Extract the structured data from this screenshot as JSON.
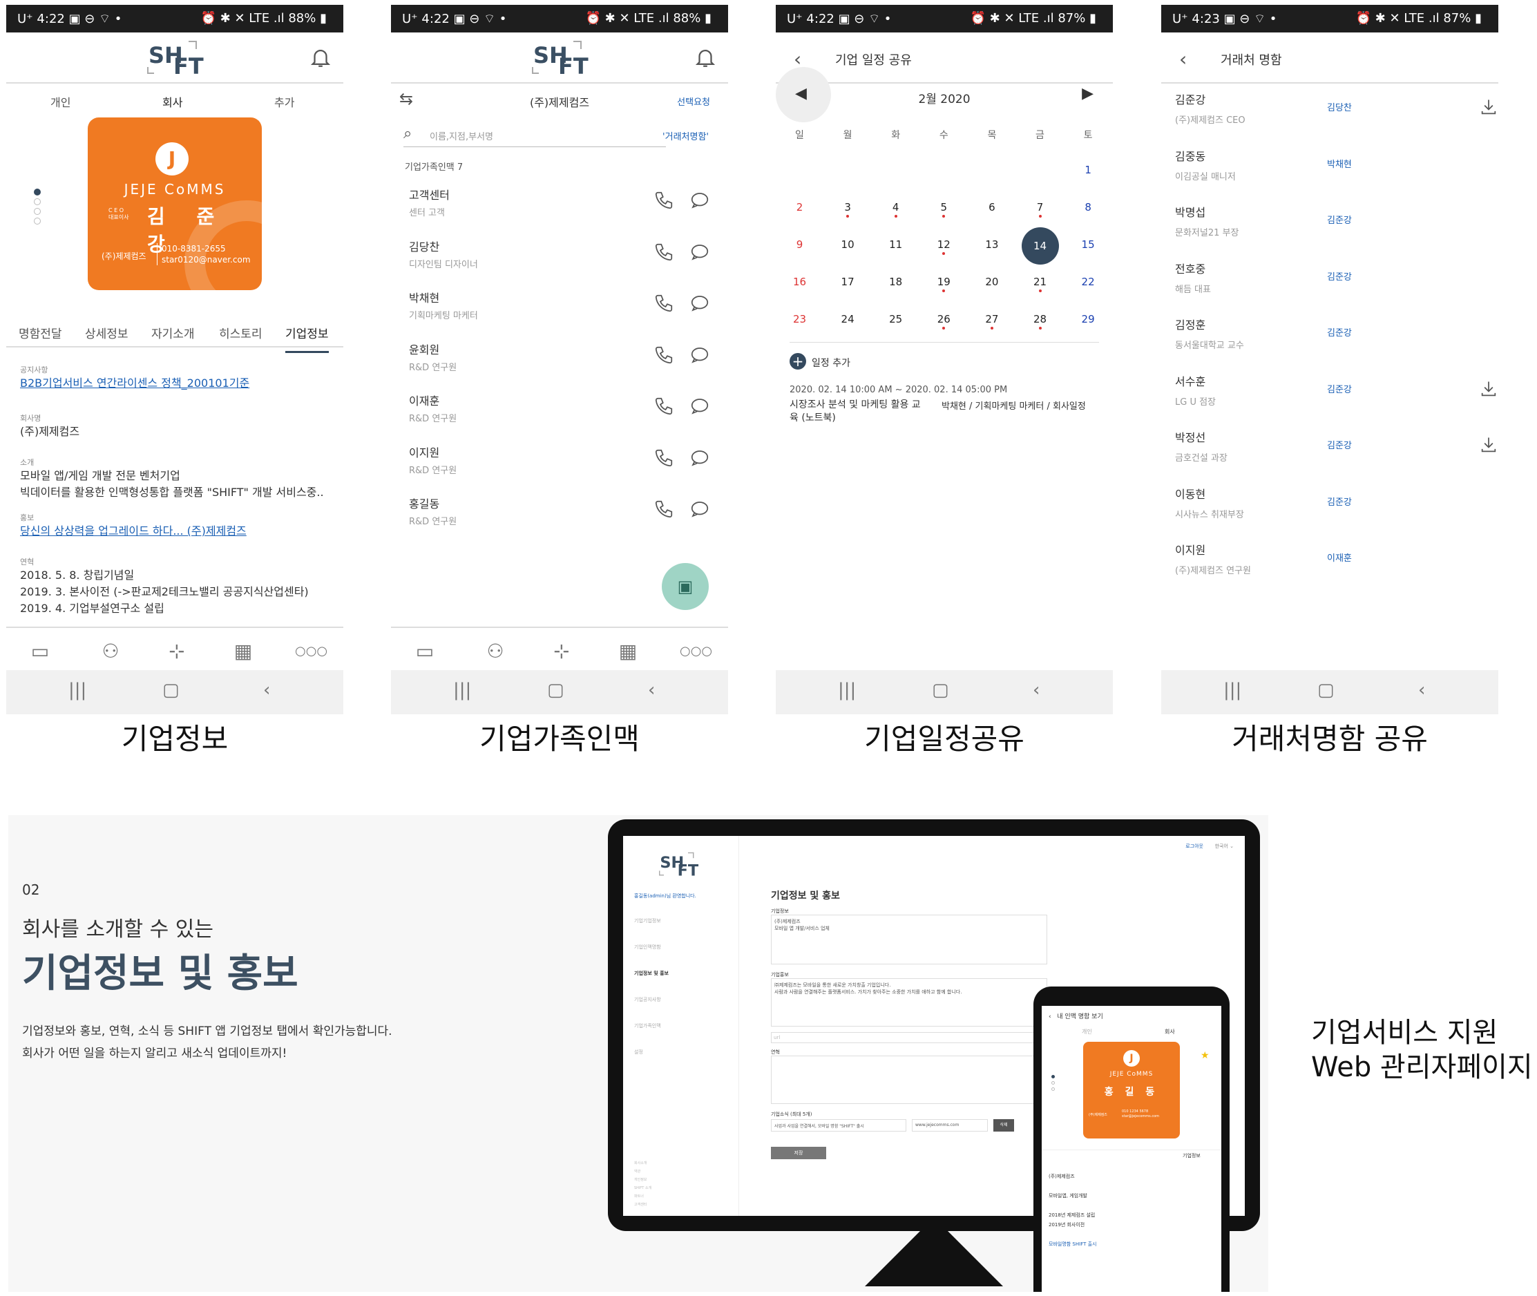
{
  "status": [
    {
      "time": "4:22",
      "battery": "88%"
    },
    {
      "time": "4:22",
      "battery": "88%"
    },
    {
      "time": "4:22",
      "battery": "87%"
    },
    {
      "time": "4:23",
      "battery": "87%"
    }
  ],
  "status_carrier": "U⁺",
  "status_net": "LTE",
  "logo": {
    "s": "SH",
    "t": "FT"
  },
  "screen1": {
    "tabs": [
      "개인",
      "회사",
      "추가"
    ],
    "card": {
      "brand": "JEJE CoMMS",
      "role": "C E O\n대표이사",
      "name": "김 준 강",
      "company": "(주)제제컴즈",
      "phone": "010-8381-2655",
      "email": "star0120@naver.com"
    },
    "subtabs": [
      "명함전달",
      "상세정보",
      "자기소개",
      "히스토리",
      "기업정보"
    ],
    "notice_label": "공지사항",
    "notice": "B2B기업서비스 연간라이센스 정책_200101기준",
    "company_label": "회사명",
    "company": "(주)제제컴즈",
    "intro_label": "소개",
    "intro1": "모바일 앱/게임 개발 전문 벤처기업",
    "intro2": "빅데이터를 활용한 인맥형성통합 플랫폼 \"SHIFT\" 개발 서비스중..",
    "promo_label": "홍보",
    "promo": "당신의 상상력을 업그레이드 하다... (주)제제컴즈",
    "history_label": "연혁",
    "history": [
      "2018. 5. 8.  창립기념일",
      "2019. 3.    본사이전 (->판교제2테크노밸리 공공지식산업센타)",
      "2019. 4.    기업부설연구소 설립"
    ],
    "caption": "기업정보"
  },
  "screen2": {
    "title": "(주)제제컴즈",
    "request": "선택요청",
    "search_placeholder": "이름,지점,부서명",
    "biz_card_link": "'거래처명함'",
    "family_label": "기업가족인맥 7",
    "contacts": [
      {
        "name": "고객센터",
        "sub": "센터 고객"
      },
      {
        "name": "김당찬",
        "sub": "디자인팀 디자이너"
      },
      {
        "name": "박채현",
        "sub": "기획마케팅 마케터"
      },
      {
        "name": "윤회원",
        "sub": "R&D 연구원"
      },
      {
        "name": "이재훈",
        "sub": "R&D 연구원"
      },
      {
        "name": "이지원",
        "sub": "R&D 연구원"
      },
      {
        "name": "홍길동",
        "sub": "R&D 연구원"
      }
    ],
    "caption": "기업가족인맥"
  },
  "screen3": {
    "title": "기업 일정 공유",
    "month": "2월 2020",
    "weekdays": [
      "일",
      "월",
      "화",
      "수",
      "목",
      "금",
      "토"
    ],
    "add_label": "일정 추가",
    "event_time": "2020. 02. 14 10:00 AM ~ 2020. 02. 14 05:00 PM",
    "event_title": "시장조사 분석 및 마케팅 활용 교육 (노트북)",
    "event_who": "박채현 / 기획마케팅 마케터 / 회사일정",
    "caption": "기업일정공유"
  },
  "screen4": {
    "title": "거래처 명함",
    "items": [
      {
        "name": "김준강",
        "sub": "(주)제제컴즈  CEO",
        "mgr": "김당찬",
        "dl": true
      },
      {
        "name": "김중동",
        "sub": "이김공실  매니저",
        "mgr": "박채현",
        "dl": false
      },
      {
        "name": "박명섭",
        "sub": "문화저널21  부장",
        "mgr": "김준강",
        "dl": false
      },
      {
        "name": "전호중",
        "sub": "해듬  대표",
        "mgr": "김준강",
        "dl": false
      },
      {
        "name": "김정훈",
        "sub": "동서울대학교  교수",
        "mgr": "김준강",
        "dl": false
      },
      {
        "name": "서수훈",
        "sub": "LG U  점장",
        "mgr": "김준강",
        "dl": true
      },
      {
        "name": "박정선",
        "sub": "금호건설  과장",
        "mgr": "김준강",
        "dl": true
      },
      {
        "name": "이동현",
        "sub": "시사뉴스  취재부장",
        "mgr": "김준강",
        "dl": false
      },
      {
        "name": "이지원",
        "sub": "(주)제제컴즈  연구원",
        "mgr": "이재훈",
        "dl": false
      }
    ],
    "caption": "거래처명함 공유"
  },
  "promo": {
    "number": "02",
    "subtitle": "회사를 소개할 수 있는",
    "title": "기업정보 및 홍보",
    "desc1": "기업정보와 홍보, 연혁, 소식 등 SHIFT 앱 기업정보 탭에서 확인가능합니다.",
    "desc2": "회사가 어떤 일을 하는지 알리고 새소식 업데이트까지!",
    "side1": "기업서비스 지원",
    "side2": "Web 관리자페이지"
  },
  "web": {
    "login": "로그아웃",
    "lang": "한국어 ⌄",
    "greeting": "홍길동(admin)님 환영합니다.",
    "menu": [
      "기업기업정보",
      "기업인맥명함",
      "기업정보 및 홍보",
      "기업공지사항",
      "기업가족인맥",
      "설정"
    ],
    "foot": [
      "회사소개",
      "약관",
      "개인정보",
      "SHIFT 소개",
      "파트너",
      "고객센터"
    ],
    "heading": "기업정보 및 홍보",
    "info_label": "기업정보",
    "info_text1": "(주)제제컴즈",
    "info_text2": "모바일 앱 개발/서비스 업체",
    "promo_label": "기업홍보",
    "promo_text1": "㈜제제컴즈는 모바일을 통한 새로운 가치창출 기업입니다.",
    "promo_text2": "사람과 사람을 연결해주는 플랫폼서비스. 가치가 찾아주는 소중한 가치를 애하고 함께 합니다.",
    "url_placeholder": "url",
    "history_label": "연혁",
    "news_label": "기업소식 (최대 5개)",
    "news_text": "사업과 사업을 연결해서, 모바일 명함 \"SHIFT\" 출시",
    "news_url": "www.jejecomms.com",
    "del": "삭제",
    "save": "저장",
    "mp_title": "내 인맥 명함 보기",
    "mp_tab1": "개인",
    "mp_tab2": "회사",
    "mp_tab3": "기업정보",
    "mp_brand": "JEJE CoMMS",
    "mp_name": "홍 길 동",
    "mp_company": "(주)제제컴즈",
    "mp_phone": "010 1234 5678",
    "mp_email": "star@jejecomms.com",
    "mp_co": "(주)제제컴즈",
    "mp_line1": "모바일앱, 게임개발",
    "mp_line2": "2018년 제제컴즈 설립",
    "mp_line3": "2019년 회사이전",
    "mp_link": "모바일명함 SHIFT 출시"
  },
  "colors": {
    "orange": "#f07a22",
    "navy": "#34495e",
    "link": "#1a5fb4",
    "teal": "#9fd4c5"
  }
}
